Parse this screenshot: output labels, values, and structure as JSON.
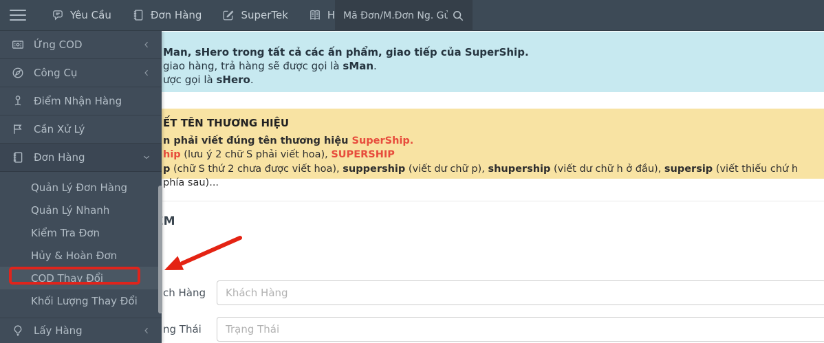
{
  "topbar": {
    "menu": [
      {
        "label": "Yêu Cầu"
      },
      {
        "label": "Đơn Hàng"
      },
      {
        "label": "SuperTek"
      },
      {
        "label": "Hướng Dẫn"
      }
    ],
    "search": {
      "placeholder": "Mã Đơn/M.Đơn Ng. Gử"
    }
  },
  "sidebar": {
    "items": [
      {
        "label": "Ứng COD"
      },
      {
        "label": "Công Cụ"
      },
      {
        "label": "Điểm Nhận Hàng"
      },
      {
        "label": "Cần Xử Lý"
      },
      {
        "label": "Đơn Hàng"
      }
    ],
    "submenu": [
      "Quản Lý Đơn Hàng",
      "Quản Lý Nhanh",
      "Kiểm Tra Đơn",
      "Hủy & Hoàn Đơn",
      "COD Thay Đổi",
      "Khối Lượng Thay Đổi"
    ],
    "active_item": "COD Thay Đổi",
    "bottom_item": {
      "label": "Lấy Hàng"
    }
  },
  "notice_blue": {
    "line1": "Man, sHero trong tất cả các ấn phẩm, giao tiếp của SuperShip.",
    "line2_pre": " giao hàng, trả hàng sẽ được gọi là ",
    "line2_bold": "sMan",
    "line2_post": ".",
    "line3_pre": "ược gọi là ",
    "line3_bold": "sHero",
    "line3_post": "."
  },
  "notice_yellow": {
    "heading": "ẾT TÊN THƯƠNG HIỆU",
    "line1_pre": "n phải viết đúng tên thương hiệu ",
    "line1_red": "SuperShip.",
    "line2_red1": "hip",
    "line2_mid": " (lưu ý 2 chữ S phải viết hoa), ",
    "line2_red2": "SUPERSHIP",
    "line3_b1": "p",
    "line3_t1": " (chữ S thứ 2 chưa được viết hoa), ",
    "line3_b2": "suppership",
    "line3_t2": " (viết dư chữ p), ",
    "line3_b3": "shupership",
    "line3_t3": " (viết dư chữ h ở đầu), ",
    "line3_b4": "supersip",
    "line3_t4": " (viết thiếu chứ h phía sau)..."
  },
  "panel": {
    "heading_fragment": "ẾM",
    "rows": [
      {
        "label_fragment": "ch Hàng",
        "placeholder": "Khách Hàng"
      },
      {
        "label_fragment": "ng Thái",
        "placeholder": "Trạng Thái"
      }
    ]
  },
  "colors": {
    "topbar_bg": "#3d4a56",
    "sidebar_bg": "#404c59",
    "active_item_bg": "#4a5763",
    "notice_blue_bg": "#c7e9f0",
    "notice_yellow_bg": "#f8e3a3",
    "annotation_red": "#e42313",
    "text_red": "#e74c3c"
  }
}
